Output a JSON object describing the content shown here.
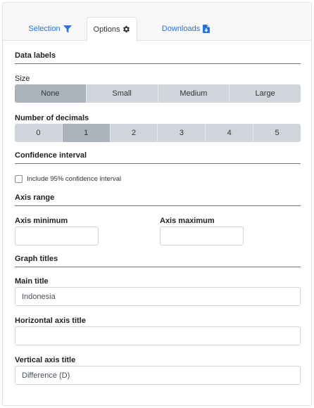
{
  "tabs": [
    {
      "label": "Selection",
      "icon": "filter-icon"
    },
    {
      "label": "Options",
      "icon": "gear-icon",
      "active": true
    },
    {
      "label": "Downloads",
      "icon": "file-download-icon"
    }
  ],
  "data_labels": {
    "title": "Data labels",
    "size_label": "Size",
    "size_options": [
      "None",
      "Small",
      "Medium",
      "Large"
    ],
    "size_selected": "None",
    "decimals_label": "Number of decimals",
    "decimals_options": [
      "0",
      "1",
      "2",
      "3",
      "4",
      "5"
    ],
    "decimals_selected": "1"
  },
  "confidence": {
    "title": "Confidence interval",
    "checkbox_label": "Include 95% confidence interval",
    "checked": false
  },
  "axis_range": {
    "title": "Axis range",
    "min_label": "Axis minimum",
    "max_label": "Axis maximum",
    "min_value": "",
    "max_value": ""
  },
  "graph_titles": {
    "title": "Graph titles",
    "main_label": "Main title",
    "main_value": "Indonesia",
    "horizontal_label": "Horizontal axis title",
    "horizontal_value": "",
    "vertical_label": "Vertical axis title",
    "vertical_value": "Difference (D)"
  },
  "colors": {
    "link": "#2a72d5",
    "segment": "#d0d5dc",
    "segment_active": "#aab3bc"
  }
}
